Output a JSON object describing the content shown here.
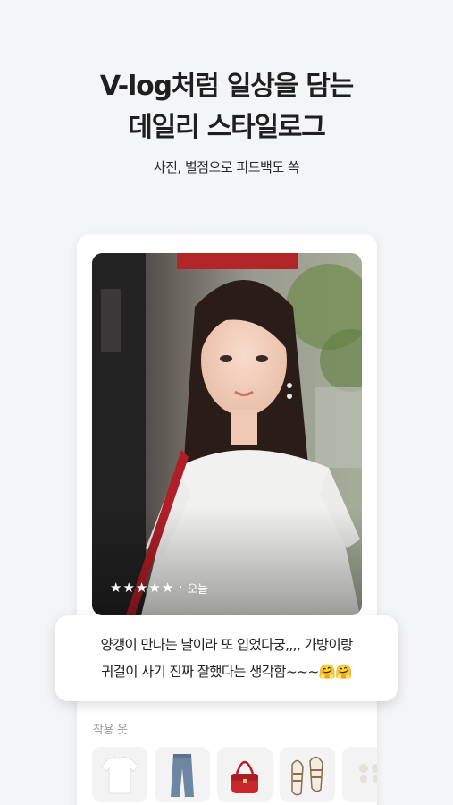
{
  "header": {
    "title_line1": "V-log처럼 일상을 담는",
    "title_line2": "데일리 스타일로그",
    "subtitle": "사진, 별점으로 피드백도 쏙"
  },
  "post": {
    "rating": 5,
    "stars": [
      "★",
      "★",
      "★",
      "★",
      "★"
    ],
    "separator": "·",
    "date": "오늘",
    "comment_line1": "양갱이 만나는 날이라 또 입었다궁,,,, 가방이랑",
    "comment_line2": "귀걸이 사기 진짜 잘했다는 생각함~~~🤗🤗"
  },
  "worn_items": {
    "label": "착용 옷",
    "items": [
      {
        "icon": "white-tshirt-icon"
      },
      {
        "icon": "jeans-icon"
      },
      {
        "icon": "red-bag-icon"
      },
      {
        "icon": "sandals-icon"
      },
      {
        "icon": "earrings-icon"
      }
    ]
  },
  "colors": {
    "background": "#f4f5f7",
    "card": "#ffffff",
    "text": "#1f1f1f",
    "muted": "#9a9a9a"
  }
}
